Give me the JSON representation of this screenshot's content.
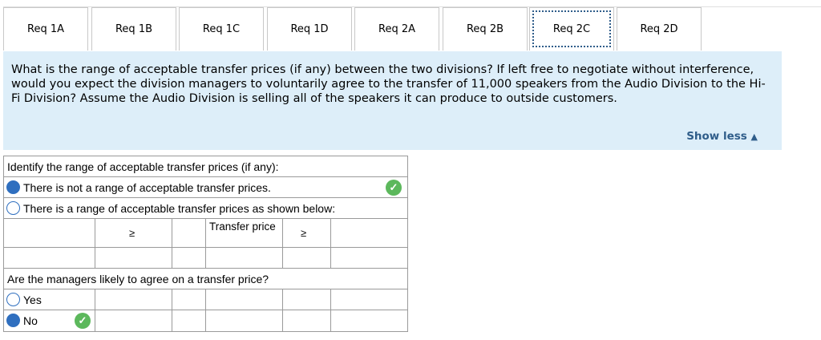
{
  "tabs": [
    "Req 1A",
    "Req 1B",
    "Req 1C",
    "Req 1D",
    "Req 2A",
    "Req 2B",
    "Req 2C",
    "Req 2D"
  ],
  "active_tab": "Req 2C",
  "question": {
    "text": "What is the range of acceptable transfer prices (if any) between the two divisions? If left free to negotiate without interference, would you expect the division managers to voluntarily agree to the transfer of 11,000 speakers from the Audio Division to the Hi-Fi Division? Assume the Audio Division is selling all of the speakers it can produce to outside customers.",
    "show_less": "Show less",
    "show_less_icon": "triangle-up-icon"
  },
  "grid": {
    "q1_prompt": "Identify the range of acceptable transfer prices (if any):",
    "option_no_range": "There is not a range of acceptable transfer prices.",
    "option_range": "There is a range of acceptable transfer prices as shown below:",
    "ge_symbol": "≥",
    "transfer_price_label": "Transfer price",
    "q2_prompt": "Are the managers likely to agree on a transfer price?",
    "yes_label": "Yes",
    "no_label": "No",
    "selected_q1": "There is not a range of acceptable transfer prices.",
    "selected_q2": "No",
    "check_icon": "check-circle-icon",
    "check_color": "#5cb85c",
    "radio_color": "#2f6fbf"
  }
}
